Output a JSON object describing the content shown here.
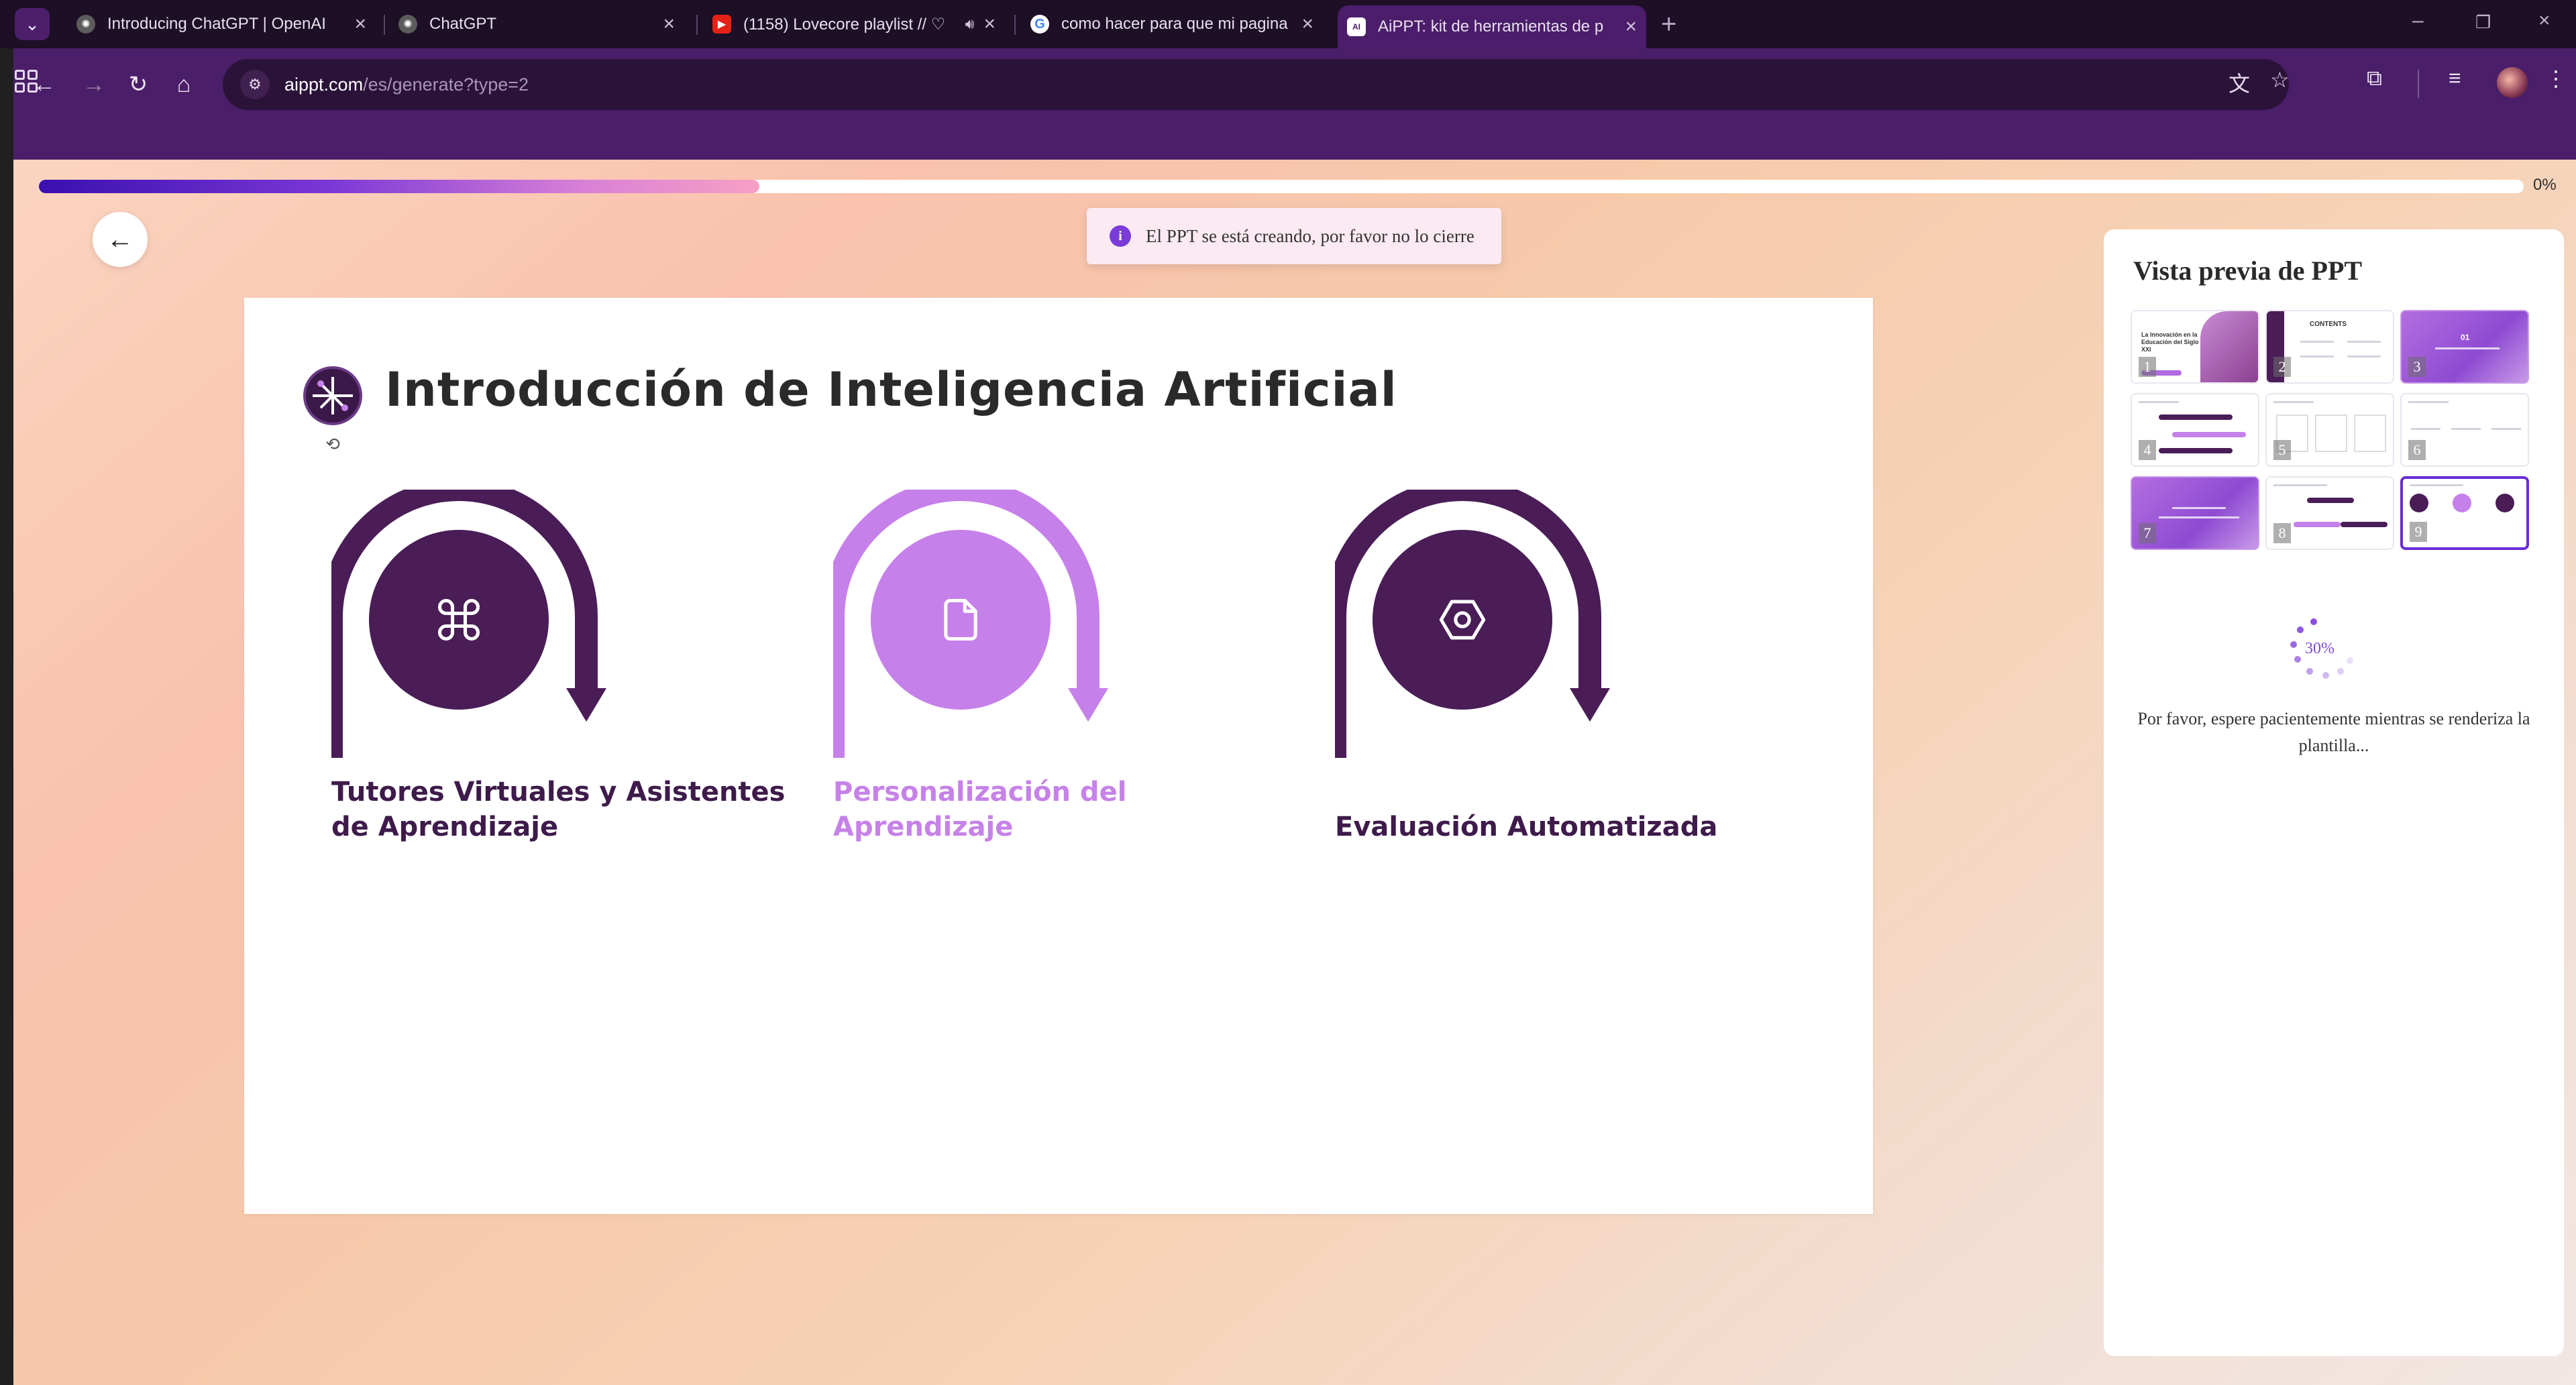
{
  "browser": {
    "tabs": [
      {
        "title": "Introducing ChatGPT | OpenAI",
        "icon": "openai-icon"
      },
      {
        "title": "ChatGPT",
        "icon": "openai-icon"
      },
      {
        "title": "(1158) Lovecore playlist // ♡",
        "icon": "youtube-icon"
      },
      {
        "title": "como hacer para que mi pagina",
        "icon": "google-icon"
      },
      {
        "title": "AiPPT: kit de herramientas de p",
        "icon": "aippt-icon",
        "active": true
      }
    ],
    "url_host": "aippt.com",
    "url_path": "/es/generate?type=2"
  },
  "page": {
    "progress_percent": 0,
    "progress_label": "0%",
    "progress_fill_fraction": 0.29,
    "toast": "El PPT se está creando, por favor no lo cierre"
  },
  "slide": {
    "title": "Introducción de Inteligencia Artificial",
    "items": [
      {
        "label": "Tutores Virtuales y Asistentes de Aprendizaje",
        "icon": "command-icon",
        "color": "#4a1d57"
      },
      {
        "label": "Personalización del Aprendizaje",
        "icon": "document-icon",
        "color": "#c680ea"
      },
      {
        "label": "Evaluación Automatizada",
        "icon": "hexagon-icon",
        "color": "#4a1d57"
      }
    ]
  },
  "preview": {
    "title": "Vista previa de PPT",
    "thumbnails": [
      "1",
      "2",
      "3",
      "4",
      "5",
      "6",
      "7",
      "8",
      "9"
    ],
    "thumbnail_texts": {
      "t1": "La Innovación en la Educación del Siglo XXI",
      "t2": "CONTENTS",
      "t3": "01"
    },
    "selected": 9,
    "render_percent": "30%",
    "wait_message": "Por favor, espere pacientemente mientras se renderiza la plantilla..."
  },
  "colors": {
    "chrome_purple": "#4a1e68",
    "accent_dark": "#4a1d57",
    "accent_light": "#c680ea",
    "toast_bg": "#fbeaf2"
  }
}
